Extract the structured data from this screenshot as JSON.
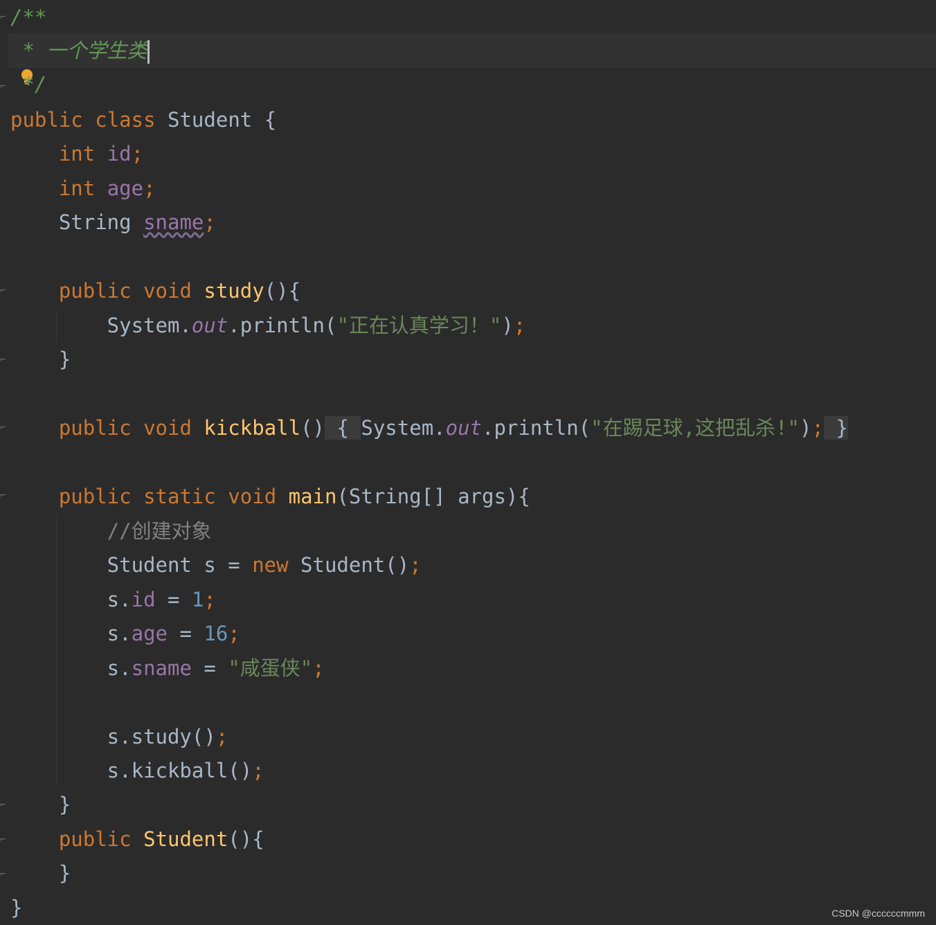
{
  "code_lines": [
    "/**",
    " * 一个学生类",
    " */",
    "public class Student {",
    "    int id;",
    "    int age;",
    "    String sname;",
    "",
    "    public void study(){",
    "        System.out.println(\"正在认真学习！\");",
    "    }",
    "",
    "    public void kickball() { System.out.println(\"在踢足球,这把乱杀!\"); }",
    "",
    "    public static void main(String[] args){",
    "        //创建对象",
    "        Student s = new Student();",
    "        s.id = 1;",
    "        s.age = 16;",
    "        s.sname = \"咸蛋侠\";",
    "",
    "        s.study();",
    "        s.kickball();",
    "    }",
    "    public Student(){",
    "    }",
    "}"
  ],
  "watermark": "CSDN @ccccccmmm",
  "theme": {
    "background": "#2b2b2b",
    "keyword": "#cc7832",
    "field": "#9876aa",
    "method": "#ffc66d",
    "string": "#6a8759",
    "number": "#6897bb",
    "comment": "#808080",
    "doc_comment": "#629755",
    "default": "#a9b7c6"
  },
  "icons": {
    "intention_bulb": "lightbulb-icon",
    "fold_marker": "fold-icon"
  }
}
